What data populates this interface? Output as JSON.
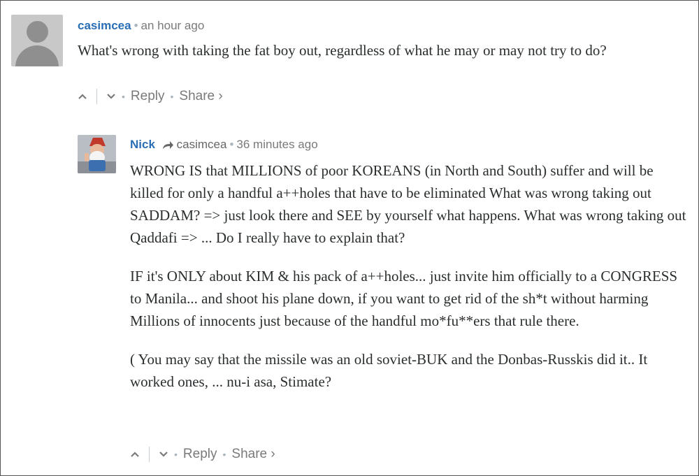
{
  "comments": [
    {
      "author": "casimcea",
      "time": "an hour ago",
      "paragraphs": [
        "What's wrong with taking the fat boy out, regardless of what he may or may not try to do?"
      ],
      "reply_label": "Reply",
      "share_label": "Share ›"
    },
    {
      "author": "Nick",
      "reply_to": "casimcea",
      "time": "36 minutes ago",
      "paragraphs": [
        "WRONG IS that MILLIONS of poor KOREANS (in North and South) suffer and will be killed for only a handful a++holes that have to be eliminated What was wrong taking out SADDAM? => just look there and SEE by yourself what happens. What was wrong taking out Qaddafi => ... Do I really have to explain that?",
        "IF it's ONLY about KIM & his pack of a++holes... just invite him officially to a CONGRESS to Manila... and shoot his plane down, if you want to get rid of the sh*t without harming Millions of innocents just because of the handful mo*fu**ers that rule there.",
        "( You may say that the missile was an old soviet-BUK and the Donbas-Russkis did it.. It worked ones, ... nu-i asa, Stimate?"
      ],
      "reply_label": "Reply",
      "share_label": "Share ›"
    }
  ],
  "colors": {
    "author": "#2a6fb5",
    "meta": "#7a7a7a",
    "text": "#2a2e2e"
  },
  "icons": {
    "upvote": "chevron-up-icon",
    "downvote": "chevron-down-icon",
    "reply_arrow": "reply-arrow-icon"
  }
}
